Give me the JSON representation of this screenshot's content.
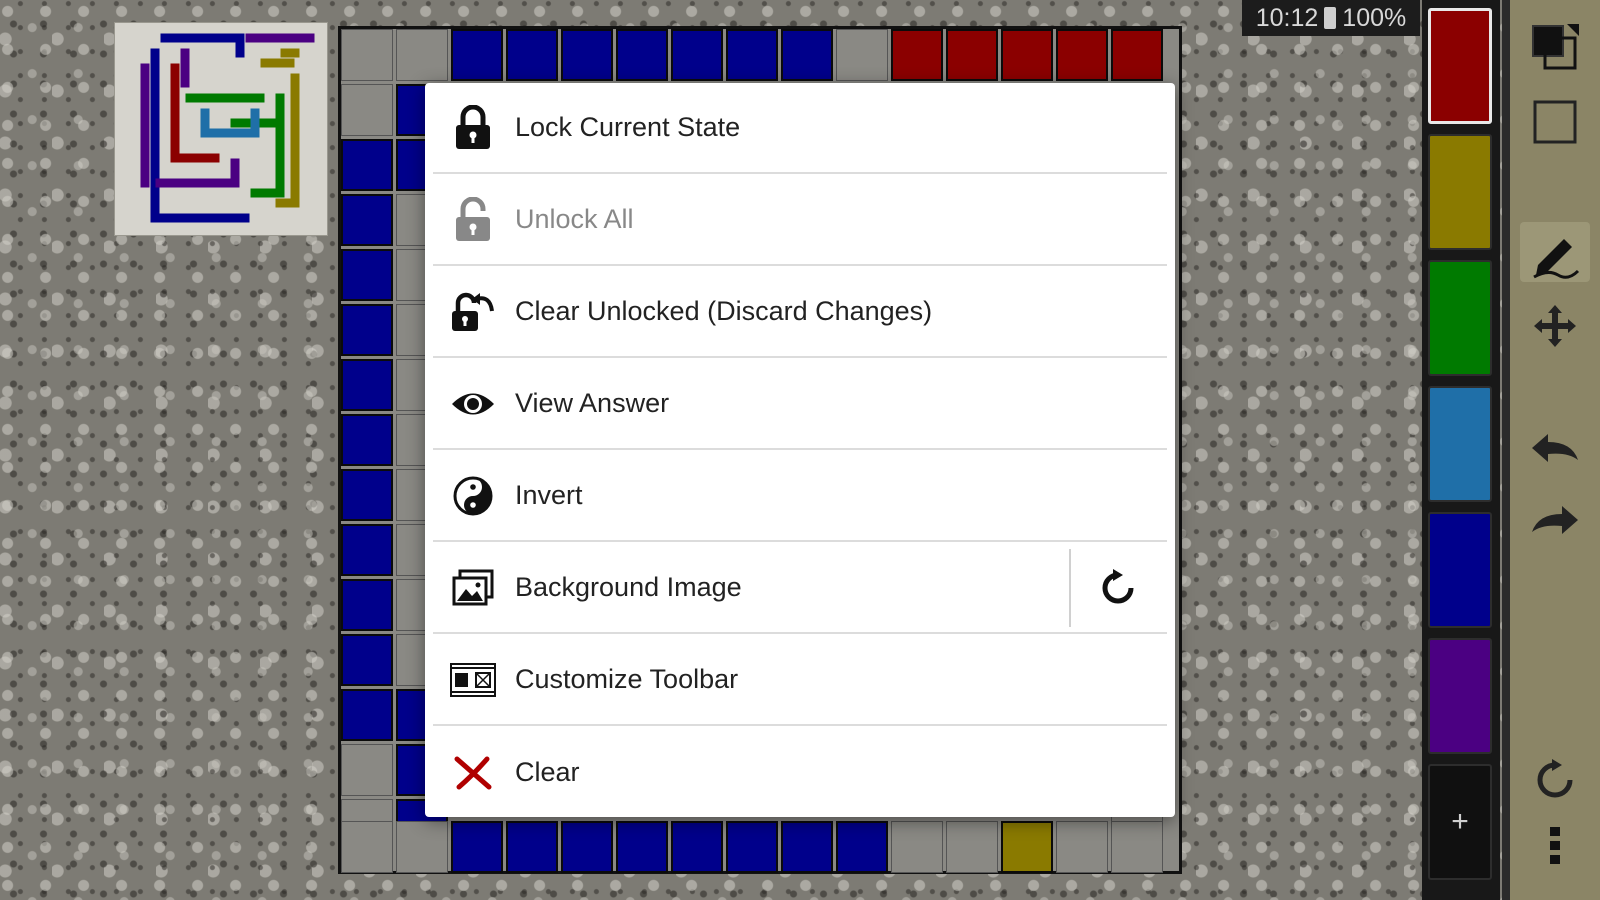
{
  "status_bar": {
    "time": "10:12",
    "battery": "100%"
  },
  "menu": {
    "items": [
      {
        "label": "Lock Current State",
        "icon": "lock-icon",
        "enabled": true
      },
      {
        "label": "Unlock All",
        "icon": "unlock-icon",
        "enabled": false
      },
      {
        "label": "Clear Unlocked (Discard Changes)",
        "icon": "unlock-undo-icon",
        "enabled": true
      },
      {
        "label": "View Answer",
        "icon": "eye-icon",
        "enabled": true
      },
      {
        "label": "Invert",
        "icon": "yin-yang-icon",
        "enabled": true
      },
      {
        "label": "Background Image",
        "icon": "image-icon",
        "enabled": true,
        "side_icon": "reset-icon"
      },
      {
        "label": "Customize Toolbar",
        "icon": "toolbar-icon",
        "enabled": true
      },
      {
        "label": "Clear",
        "icon": "close-x-icon",
        "enabled": true
      }
    ]
  },
  "palette": {
    "colors": [
      "#8b0000",
      "#8a7a00",
      "#007a00",
      "#1f6fa8",
      "#00008b",
      "#4b0082"
    ],
    "selected_index": 0,
    "add_label": "+"
  },
  "tools": [
    "fill-mode-icon",
    "empty-mode-icon",
    "pencil-icon",
    "move-icon",
    "undo-icon",
    "redo-icon",
    "refresh-icon",
    "more-vert-icon"
  ],
  "colors": {
    "blue": "#00008b",
    "red": "#8b0000",
    "yellow": "#8a7a00",
    "green": "#007a00",
    "teal": "#1f6fa8",
    "purple": "#4b0082"
  }
}
